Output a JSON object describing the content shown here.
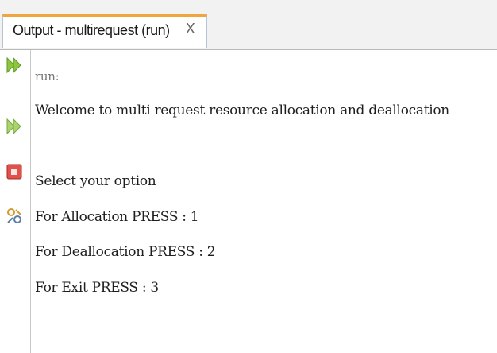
{
  "tab": {
    "title": "Output - multirequest (run)",
    "close_glyph": "X"
  },
  "gutter": {
    "buttons": [
      {
        "name": "rerun-icon",
        "color": "#7cbf3a"
      },
      {
        "name": "rerun-with-options-icon",
        "color": "#7cbf3a"
      },
      {
        "name": "stop-icon",
        "color": "#e0413a"
      },
      {
        "name": "settings-icon",
        "color": "#6b8fb3"
      }
    ]
  },
  "output": {
    "run_line": "run:",
    "lines": [
      "Welcome to multi request resource allocation and deallocation",
      "",
      "Select your option",
      "For Allocation PRESS : 1",
      "For Deallocation PRESS : 2",
      "For Exit PRESS : 3"
    ]
  }
}
